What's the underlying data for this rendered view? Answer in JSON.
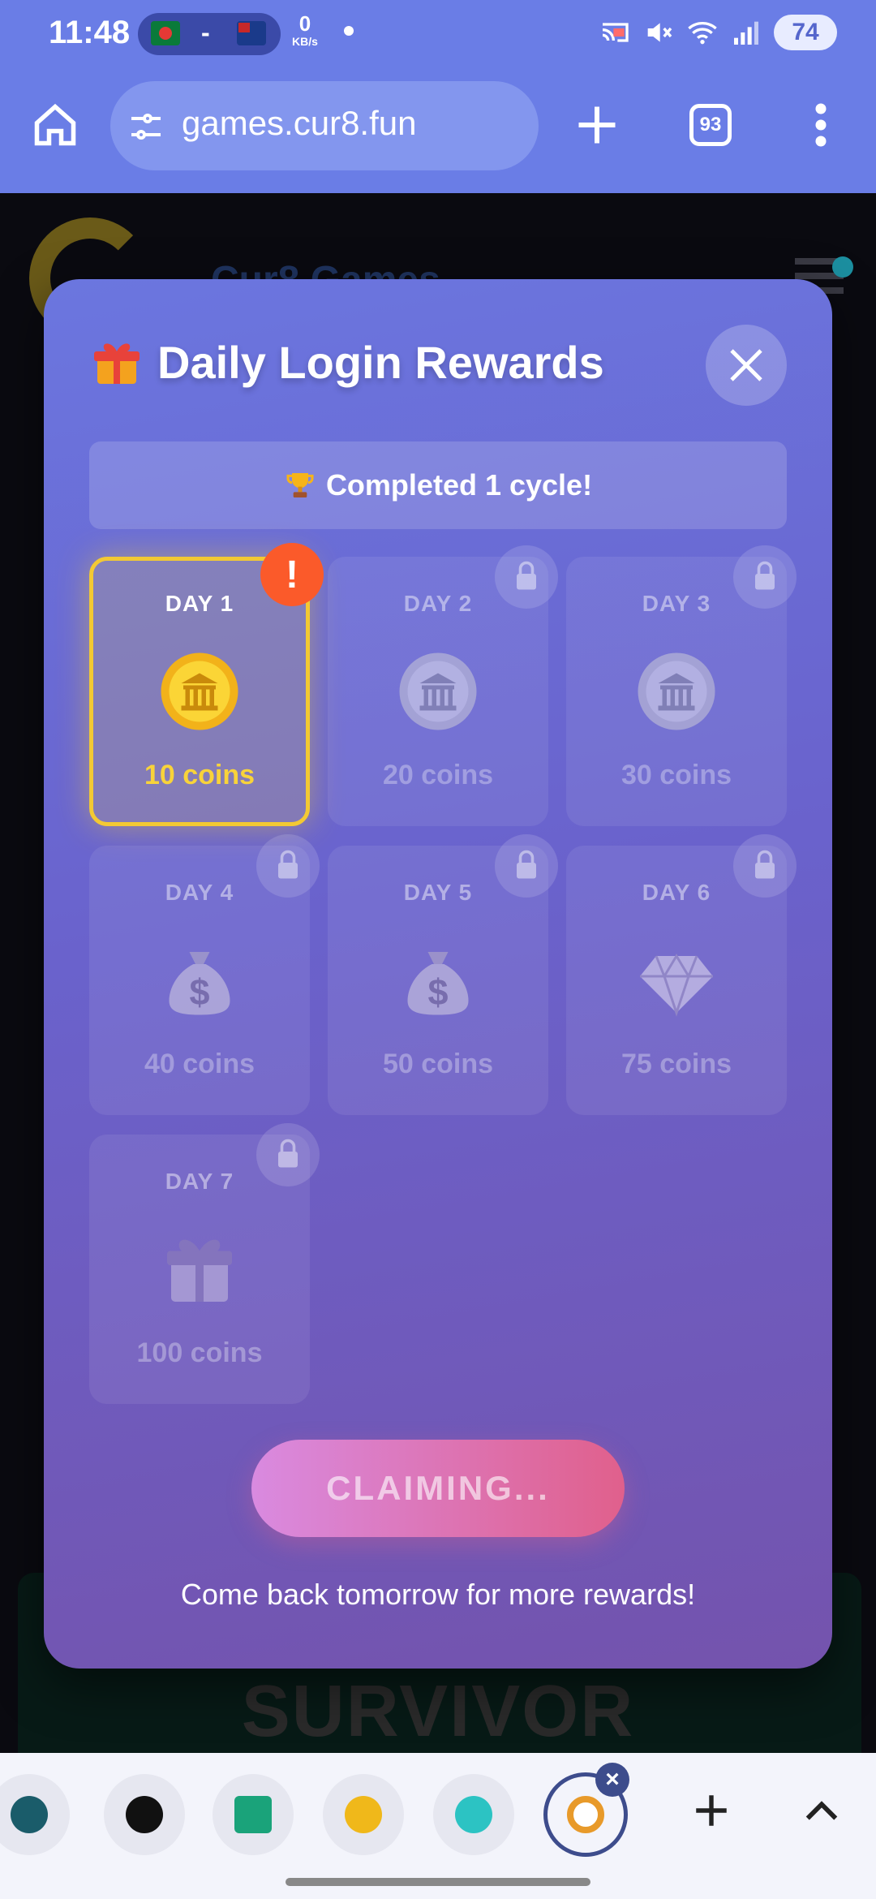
{
  "status_bar": {
    "time": "11:48",
    "separator": "-",
    "net_speed": "0",
    "net_unit": "KB/s",
    "battery": "74"
  },
  "browser": {
    "url": "games.cur8.fun",
    "tab_count": "93"
  },
  "background_page": {
    "brand": "Cur8 Games",
    "banner_title": "SURVIVOR"
  },
  "modal": {
    "title": "Daily Login Rewards",
    "cycle_status": "Completed 1 cycle!",
    "days": [
      {
        "label": "DAY 1",
        "reward": "10 coins",
        "icon": "gold-coin-icon",
        "state": "claimable",
        "badge": "!"
      },
      {
        "label": "DAY 2",
        "reward": "20 coins",
        "icon": "silver-coin-icon",
        "state": "locked"
      },
      {
        "label": "DAY 3",
        "reward": "30 coins",
        "icon": "silver-coin-icon",
        "state": "locked"
      },
      {
        "label": "DAY 4",
        "reward": "40 coins",
        "icon": "money-bag-icon",
        "state": "locked"
      },
      {
        "label": "DAY 5",
        "reward": "50 coins",
        "icon": "money-bag-icon",
        "state": "locked"
      },
      {
        "label": "DAY 6",
        "reward": "75 coins",
        "icon": "diamond-icon",
        "state": "locked"
      },
      {
        "label": "DAY 7",
        "reward": "100 coins",
        "icon": "gift-box-icon",
        "state": "locked"
      }
    ],
    "claim_button": "CLAIMING...",
    "footer_note": "Come back tomorrow for more rewards!"
  },
  "colors": {
    "accent_gold": "#f3c933",
    "alert": "#fb5a2a",
    "chrome": "#6a7de6",
    "claim_start": "#d98ae0",
    "claim_end": "#e0608c"
  },
  "tab_strip": {
    "close_glyph": "×"
  }
}
